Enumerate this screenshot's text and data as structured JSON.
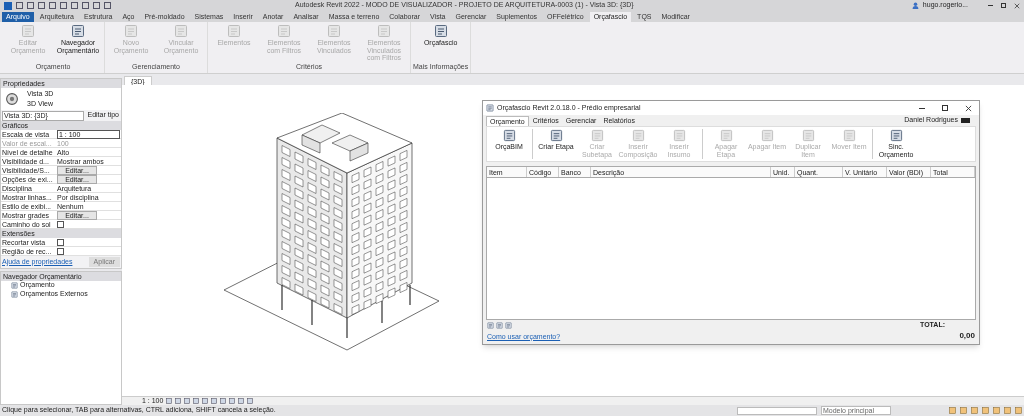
{
  "window": {
    "title": "Autodesk Revit 2022 - MODO DE VISUALIZADOR - PROJETO DE ARQUITETURA-0003 (1) - Vista 3D: {3D}",
    "user": "hugo.rogerio..."
  },
  "ribbon_tabs": [
    {
      "label": "Arquivo",
      "selected": false,
      "kind": "file"
    },
    {
      "label": "Arquitetura",
      "selected": false,
      "kind": "tab"
    },
    {
      "label": "Estrutura",
      "selected": false,
      "kind": "tab"
    },
    {
      "label": "Aço",
      "selected": false,
      "kind": "tab"
    },
    {
      "label": "Pré-moldado",
      "selected": false,
      "kind": "tab"
    },
    {
      "label": "Sistemas",
      "selected": false,
      "kind": "tab"
    },
    {
      "label": "Inserir",
      "selected": false,
      "kind": "tab"
    },
    {
      "label": "Anotar",
      "selected": false,
      "kind": "tab"
    },
    {
      "label": "Analisar",
      "selected": false,
      "kind": "tab"
    },
    {
      "label": "Massa e terreno",
      "selected": false,
      "kind": "tab"
    },
    {
      "label": "Colaborar",
      "selected": false,
      "kind": "tab"
    },
    {
      "label": "Vista",
      "selected": false,
      "kind": "tab"
    },
    {
      "label": "Gerenciar",
      "selected": false,
      "kind": "tab"
    },
    {
      "label": "Suplementos",
      "selected": false,
      "kind": "tab"
    },
    {
      "label": "OFFelétrico",
      "selected": false,
      "kind": "tab"
    },
    {
      "label": "Orçafascio",
      "selected": true,
      "kind": "tab"
    },
    {
      "label": "TQS",
      "selected": false,
      "kind": "tab"
    },
    {
      "label": "Modificar",
      "selected": false,
      "kind": "tab"
    }
  ],
  "ribbon_panels": [
    {
      "label": "Orçamento",
      "buttons": [
        {
          "label": "Editar Orçamento",
          "disabled": true
        },
        {
          "label": "Navegador Orçamentário",
          "disabled": false
        }
      ]
    },
    {
      "label": "Gerenciamento",
      "buttons": [
        {
          "label": "Novo Orçamento",
          "disabled": true
        },
        {
          "label": "Vincular Orçamento",
          "disabled": true
        }
      ]
    },
    {
      "label": "Critérios",
      "buttons": [
        {
          "label": "Elementos",
          "disabled": true
        },
        {
          "label": "Elementos com Filtros",
          "disabled": true
        },
        {
          "label": "Elementos Vinculados",
          "disabled": true
        },
        {
          "label": "Elementos Vinculados com Filtros",
          "disabled": true
        }
      ]
    },
    {
      "label": "Mais Informações",
      "buttons": [
        {
          "label": "Orçafascio",
          "disabled": false
        }
      ]
    }
  ],
  "properties": {
    "title": "Propriedades",
    "type_name": "Vista 3D",
    "type_sub": "3D View",
    "selector": "Vista 3D: {3D}",
    "edit_type": "Editar tipo",
    "sections": [
      {
        "label": "Gráficos",
        "rows": [
          {
            "name": "Escala de vista",
            "value": "1 : 100",
            "kind": "input",
            "disabled": false
          },
          {
            "name": "Valor de escal...",
            "value": "100",
            "kind": "text",
            "disabled": true
          },
          {
            "name": "Nível de detalhe",
            "value": "Alto",
            "kind": "text",
            "disabled": false
          },
          {
            "name": "Visibilidade d...",
            "value": "Mostrar ambos",
            "kind": "text",
            "disabled": false
          },
          {
            "name": "Visibilidade/S...",
            "value": "Editar...",
            "kind": "button",
            "disabled": false
          },
          {
            "name": "Opções de exi...",
            "value": "Editar...",
            "kind": "button",
            "disabled": false
          },
          {
            "name": "Disciplina",
            "value": "Arquitetura",
            "kind": "text",
            "disabled": false
          },
          {
            "name": "Mostrar linhas...",
            "value": "Por disciplina",
            "kind": "text",
            "disabled": false
          },
          {
            "name": "Estilo de exibi...",
            "value": "Nenhum",
            "kind": "text",
            "disabled": false
          },
          {
            "name": "Mostrar grades",
            "value": "Editar...",
            "kind": "button",
            "disabled": false
          },
          {
            "name": "Caminho do sol",
            "checked": false,
            "kind": "checkbox",
            "disabled": false
          }
        ]
      },
      {
        "label": "Extensões",
        "rows": [
          {
            "name": "Recortar vista",
            "checked": false,
            "kind": "checkbox",
            "disabled": false
          },
          {
            "name": "Região de rec...",
            "checked": false,
            "kind": "checkbox",
            "disabled": false
          }
        ]
      }
    ],
    "help_link": "Ajuda de propriedades",
    "apply": "Aplicar"
  },
  "browser": {
    "title": "Navegador Orçamentário",
    "items": [
      "Orçamento",
      "Orçamentos Externos"
    ]
  },
  "view_tab": "{3D}",
  "dialog": {
    "title": "Orçafascio Revit 2.0.18.0 - Prédio empresarial",
    "user": "Daniel Rodrigues",
    "tabs": [
      {
        "label": "Orçamento",
        "selected": true
      },
      {
        "label": "Critérios",
        "selected": false
      },
      {
        "label": "Gerenciar",
        "selected": false
      },
      {
        "label": "Relatórios",
        "selected": false
      }
    ],
    "toolbar_groups": [
      [
        {
          "label": "OrçaBIM",
          "disabled": false
        }
      ],
      [
        {
          "label": "Criar Etapa",
          "disabled": false
        },
        {
          "label": "Criar Subetapa",
          "disabled": true
        },
        {
          "label": "Inserir Composição",
          "disabled": true
        },
        {
          "label": "Inserir Insumo",
          "disabled": true
        }
      ],
      [
        {
          "label": "Apagar Etapa",
          "disabled": true
        },
        {
          "label": "Apagar Item",
          "disabled": true
        },
        {
          "label": "Duplicar Item",
          "disabled": true
        },
        {
          "label": "Mover Item",
          "disabled": true
        }
      ],
      [
        {
          "label": "Sinc. Orçamento",
          "disabled": false
        }
      ]
    ],
    "columns": [
      "Item",
      "Código",
      "Banco",
      "Descrição",
      "Unid.",
      "Quant.",
      "V. Unitário",
      "Valor (BDI)",
      "Total"
    ],
    "total_label": "TOTAL:",
    "total": "0,00",
    "help_link": "Como usar orçamento?"
  },
  "view_bar": {
    "scale": "1 : 100"
  },
  "status_bar": {
    "message": "Clique para selecionar, TAB para alternativas, CTRL adiciona, SHIFT cancela a seleção.",
    "model": "Modelo principal"
  }
}
